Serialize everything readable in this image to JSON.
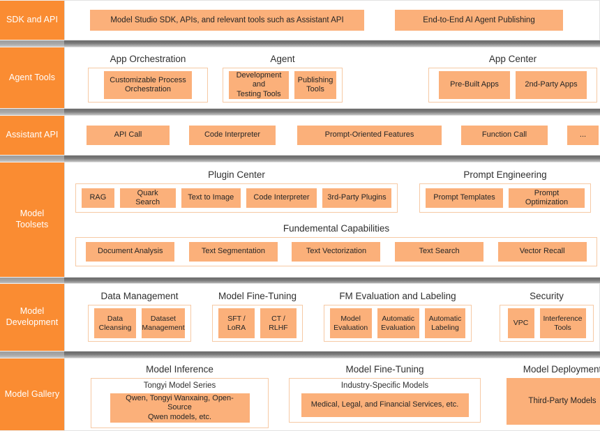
{
  "colors": {
    "sidebar_orange": "#fa8c32",
    "chip_fill": "#fbb07a",
    "chip_border": "#f6c9a4",
    "separator_dark": "#6a6a6a",
    "separator_light": "#a8a8a8",
    "text_dark": "#252525"
  },
  "rows": {
    "sdk": {
      "label": "SDK and API",
      "chips": [
        "Model Studio SDK, APIs, and relevant tools such as Assistant API",
        "End-to-End AI Agent Publishing"
      ]
    },
    "agent_tools": {
      "label": "Agent Tools",
      "groups": [
        {
          "title": "App Orchestration",
          "chips": [
            "Customizable Process\nOrchestration"
          ]
        },
        {
          "title": "Agent",
          "chips": [
            "Development and\nTesting Tools",
            "Publishing\nTools"
          ]
        },
        {
          "title": "App Center",
          "chips": [
            "Pre-Built Apps",
            "2nd-Party Apps"
          ]
        }
      ]
    },
    "assistant_api": {
      "label": "Assistant API",
      "chips": [
        "API Call",
        "Code Interpreter",
        "Prompt-Oriented Features",
        "Function Call",
        "..."
      ]
    },
    "model_toolsets": {
      "label": "Model\nToolsets",
      "groups_upper": [
        {
          "title": "Plugin Center",
          "chips": [
            "RAG",
            "Quark Search",
            "Text to Image",
            "Code Interpreter",
            "3rd-Party Plugins"
          ]
        },
        {
          "title": "Prompt Engineering",
          "chips": [
            "Prompt Templates",
            "Prompt Optimization"
          ]
        }
      ],
      "groups_lower": [
        {
          "title": "Fundemental Capabilities",
          "chips": [
            "Document Analysis",
            "Text Segmentation",
            "Text Vectorization",
            "Text Search",
            "Vector Recall"
          ]
        }
      ]
    },
    "model_development": {
      "label": "Model\nDevelopment",
      "groups": [
        {
          "title": "Data Management",
          "chips": [
            "Data\nCleansing",
            "Dataset\nManagement"
          ]
        },
        {
          "title": "Model Fine-Tuning",
          "chips": [
            "SFT / LoRA",
            "CT / RLHF"
          ]
        },
        {
          "title": "FM Evaluation and Labeling",
          "chips": [
            "Model\nEvaluation",
            "Automatic\nEvaluation",
            "Automatic\nLabeling"
          ]
        },
        {
          "title": "Security",
          "chips": [
            "VPC",
            "Interference\nTools"
          ]
        }
      ]
    },
    "model_gallery": {
      "label": "Model Gallery",
      "groups": [
        {
          "title": "Model Inference",
          "nested_title": "Tongyi Model Series",
          "chips": [
            "Qwen, Tongyi Wanxaing, Open-Source\nQwen models, etc."
          ]
        },
        {
          "title": "Model Fine-Tuning",
          "nested_title": "Industry-Specific Models",
          "chips": [
            "Medical, Legal, and Financial Services, etc."
          ]
        },
        {
          "title": "Model Deployment",
          "nested_title": "",
          "chips": [
            "Third-Party Models"
          ]
        }
      ]
    }
  }
}
